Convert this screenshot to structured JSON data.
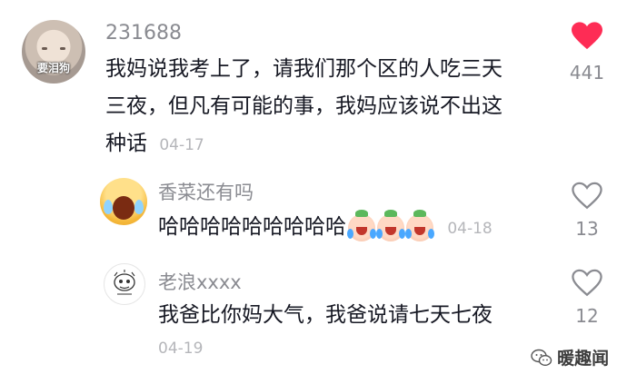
{
  "comment": {
    "avatar_caption": "要泪狗",
    "username": "231688",
    "lines": [
      "我妈说我考上了，请我们那个区的人吃三天",
      "三夜，但凡有可能的事，我妈应该说不出这",
      "种话"
    ],
    "date": "04-17",
    "like_icon": "heart-filled-icon",
    "like_count": "441",
    "like_color": "#fe2c55"
  },
  "replies": [
    {
      "username": "香菜还有吗",
      "text": "哈哈哈哈哈哈哈哈哈",
      "date": "04-18",
      "like_count": "13",
      "avatar_icon": "crying-laughing-emoji-avatar"
    },
    {
      "username": "老浪xxxx",
      "text": "我爸比你妈大气，我爸说请七天七夜",
      "date": "04-19",
      "like_count": "12",
      "avatar_icon": "doodle-avatar"
    }
  ],
  "watermark": {
    "icon": "wechat-icon",
    "text": "暖趣闻"
  }
}
